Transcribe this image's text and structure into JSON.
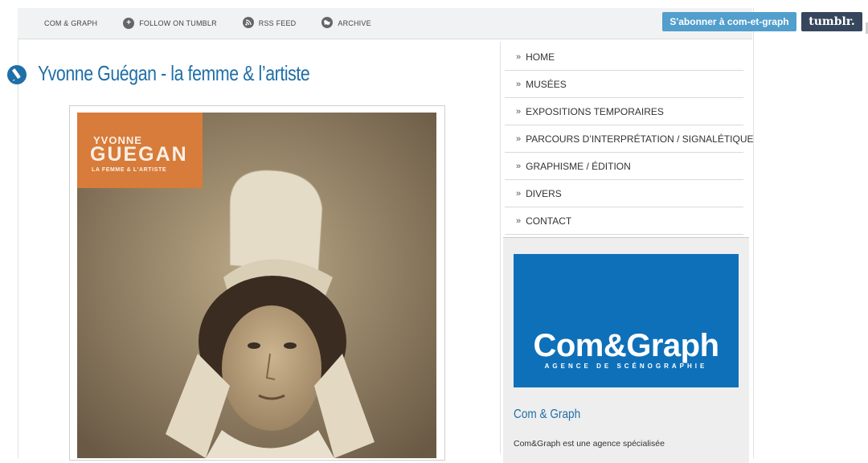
{
  "topnav": {
    "items": [
      {
        "label": "COM & GRAPH",
        "icon": null
      },
      {
        "label": "FOLLOW ON TUMBLR",
        "icon": "plus-circle-icon"
      },
      {
        "label": "RSS FEED",
        "icon": "rss-icon"
      },
      {
        "label": "ARCHIVE",
        "icon": "globe-icon"
      }
    ]
  },
  "tumblr": {
    "subscribe_label": "S'abonner à com-et-graph",
    "logo_label": "tumblr."
  },
  "post": {
    "title": "Yvonne Guégan - la femme & l’artiste",
    "title_icon": "pencil-icon",
    "image": {
      "banner_line1": "YVONNE",
      "banner_line2": "GUEGAN",
      "banner_line3": "LA FEMME & L'ARTISTE"
    }
  },
  "sidebar": {
    "menu": [
      {
        "label": "HOME"
      },
      {
        "label": "MUSÉES"
      },
      {
        "label": "EXPOSITIONS TEMPORAIRES"
      },
      {
        "label": "PARCOURS D’INTERPRÉTATION / SIGNALÉTIQUE"
      },
      {
        "label": "GRAPHISME / ÉDITION"
      },
      {
        "label": "DIVERS"
      },
      {
        "label": "CONTACT"
      }
    ],
    "widget": {
      "logo_text": "Com&Graph",
      "logo_tagline": "AGENCE DE SCÉNOGRAPHIE",
      "title": "Com & Graph",
      "description": "Com&Graph est une agence spécialisée"
    }
  },
  "colors": {
    "accent_blue": "#1f6fa8",
    "logo_blue": "#0e70b9",
    "subscribe_blue": "#529ecc",
    "tumblr_navy": "#36465d",
    "banner_orange": "#d77c3a"
  }
}
